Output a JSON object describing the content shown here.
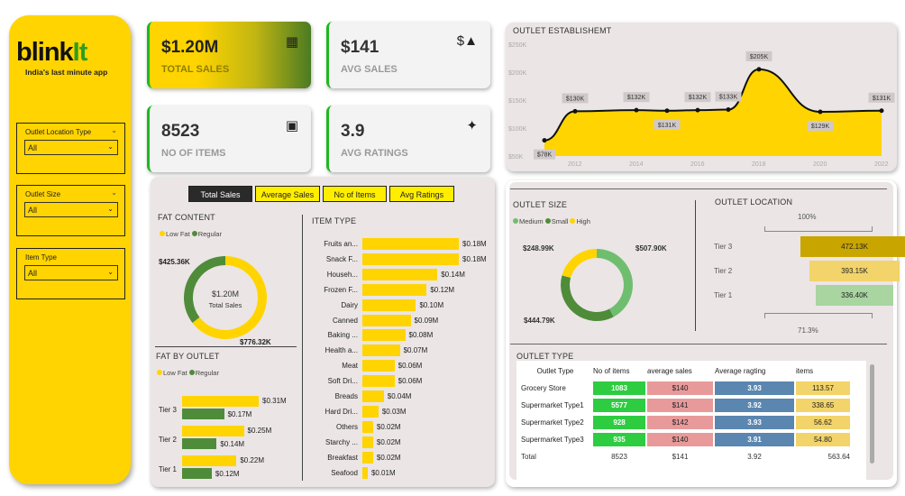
{
  "brand": {
    "name_a": "blink",
    "name_b": "It",
    "tagline": "India's last minute app"
  },
  "filters": [
    {
      "label": "Outlet Location Type",
      "value": "All"
    },
    {
      "label": "Outlet Size",
      "value": "All"
    },
    {
      "label": "Item Type",
      "value": "All"
    }
  ],
  "kpis": [
    {
      "value": "$1.20M",
      "label": "TOTAL SALES"
    },
    {
      "value": "$141",
      "label": "AVG SALES"
    },
    {
      "value": "8523",
      "label": "NO OF ITEMS"
    },
    {
      "value": "3.9",
      "label": "AVG RATINGS"
    }
  ],
  "metric_tabs": [
    "Total Sales",
    "Average Sales",
    "No of Items",
    "Avg Ratings"
  ],
  "colors": {
    "yellow": "#ffd400",
    "green": "#4e8c3a",
    "light_green": "#6fbe6f",
    "sidebar": "#ffd400"
  },
  "chart_data": [
    {
      "type": "pie",
      "title": "FAT CONTENT",
      "legend": [
        "Low Fat",
        "Regular"
      ],
      "values": [
        776.32,
        425.36
      ],
      "value_labels": [
        "$776.32K",
        "$425.36K"
      ],
      "center_value": "$1.20M",
      "center_label": "Total Sales"
    },
    {
      "type": "bar",
      "title": "FAT BY OUTLET",
      "legend": [
        "Low Fat",
        "Regular"
      ],
      "categories": [
        "Tier 3",
        "Tier 2",
        "Tier 1"
      ],
      "series": [
        {
          "name": "Low Fat",
          "values": [
            0.31,
            0.25,
            0.22
          ],
          "labels": [
            "$0.31M",
            "$0.25M",
            "$0.22M"
          ]
        },
        {
          "name": "Regular",
          "values": [
            0.17,
            0.14,
            0.12
          ],
          "labels": [
            "$0.17M",
            "$0.14M",
            "$0.12M"
          ]
        }
      ]
    },
    {
      "type": "bar",
      "title": "ITEM TYPE",
      "categories": [
        "Fruits an...",
        "Snack F...",
        "Househ...",
        "Frozen F...",
        "Dairy",
        "Canned",
        "Baking ...",
        "Health a...",
        "Meat",
        "Soft Dri...",
        "Breads",
        "Hard Dri...",
        "Others",
        "Starchy ...",
        "Breakfast",
        "Seafood"
      ],
      "values": [
        0.18,
        0.18,
        0.14,
        0.12,
        0.1,
        0.09,
        0.08,
        0.07,
        0.06,
        0.06,
        0.04,
        0.03,
        0.02,
        0.02,
        0.02,
        0.01
      ],
      "labels": [
        "$0.18M",
        "$0.18M",
        "$0.14M",
        "$0.12M",
        "$0.10M",
        "$0.09M",
        "$0.08M",
        "$0.07M",
        "$0.06M",
        "$0.06M",
        "$0.04M",
        "$0.03M",
        "$0.02M",
        "$0.02M",
        "$0.02M",
        "$0.01M"
      ]
    },
    {
      "type": "area",
      "title": "OUTLET ESTABLISHEMT",
      "x": [
        2011,
        2012,
        2014,
        2015,
        2016,
        2017,
        2018,
        2020,
        2022
      ],
      "values": [
        78,
        130,
        132,
        131,
        132,
        133,
        205,
        129,
        131
      ],
      "labels": [
        "$78K",
        "$130K",
        "$132K",
        "$131K",
        "$132K",
        "$133K",
        "$205K",
        "$129K",
        "$131K"
      ],
      "xticks": [
        "2012",
        "2014",
        "2016",
        "2018",
        "2020",
        "2022"
      ],
      "yticks": [
        "$50K",
        "$100K",
        "$150K",
        "$200K",
        "$250K"
      ],
      "ylim": [
        50,
        250
      ]
    },
    {
      "type": "pie",
      "title": "OUTLET SIZE",
      "legend": [
        "Medium",
        "Small",
        "High"
      ],
      "values": [
        507.9,
        444.79,
        248.99
      ],
      "value_labels": [
        "$507.90K",
        "$444.79K",
        "$248.99K"
      ]
    },
    {
      "type": "bar",
      "title": "OUTLET LOCATION",
      "categories": [
        "Tier 3",
        "Tier 2",
        "Tier 1"
      ],
      "values": [
        472.13,
        393.15,
        336.4
      ],
      "labels": [
        "472.13K",
        "393.15K",
        "336.40K"
      ],
      "top_pct": "100%",
      "bottom_pct": "71.3%"
    }
  ],
  "outlet_type": {
    "title": "OUTLET TYPE",
    "headers": [
      "Outlet Type",
      "No of items",
      "average sales",
      "Average ragting",
      "items"
    ],
    "rows": [
      [
        "Grocery Store",
        "1083",
        "$140",
        "3.93",
        "113.57"
      ],
      [
        "Supermarket Type1",
        "5577",
        "$141",
        "3.92",
        "338.65"
      ],
      [
        "Supermarket Type2",
        "928",
        "$142",
        "3.93",
        "56.62"
      ],
      [
        "Supermarket Type3",
        "935",
        "$140",
        "3.91",
        "54.80"
      ]
    ],
    "total": [
      "Total",
      "8523",
      "$141",
      "3.92",
      "563.64"
    ]
  }
}
